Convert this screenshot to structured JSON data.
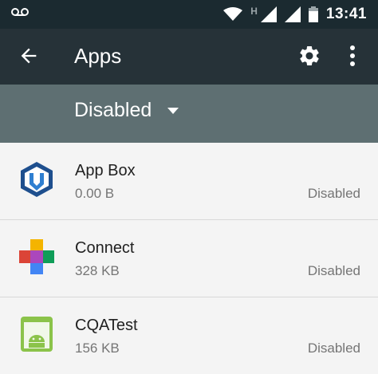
{
  "status_bar": {
    "network_type": "H",
    "time": "13:41"
  },
  "app_bar": {
    "title": "Apps",
    "back_icon": "arrow-back-icon",
    "settings_icon": "gear-icon",
    "more_icon": "more-vert-icon"
  },
  "filter": {
    "selected": "Disabled"
  },
  "apps": [
    {
      "name": "App Box",
      "size": "0.00 B",
      "status": "Disabled",
      "icon": "app-box-icon"
    },
    {
      "name": "Connect",
      "size": "328 KB",
      "status": "Disabled",
      "icon": "connect-icon"
    },
    {
      "name": "CQATest",
      "size": "156 KB",
      "status": "Disabled",
      "icon": "android-icon"
    }
  ],
  "colors": {
    "status_bar": "#1b2a30",
    "app_bar": "#263238",
    "filter_bar": "#5e6f72",
    "list_background": "#f4f4f4"
  }
}
